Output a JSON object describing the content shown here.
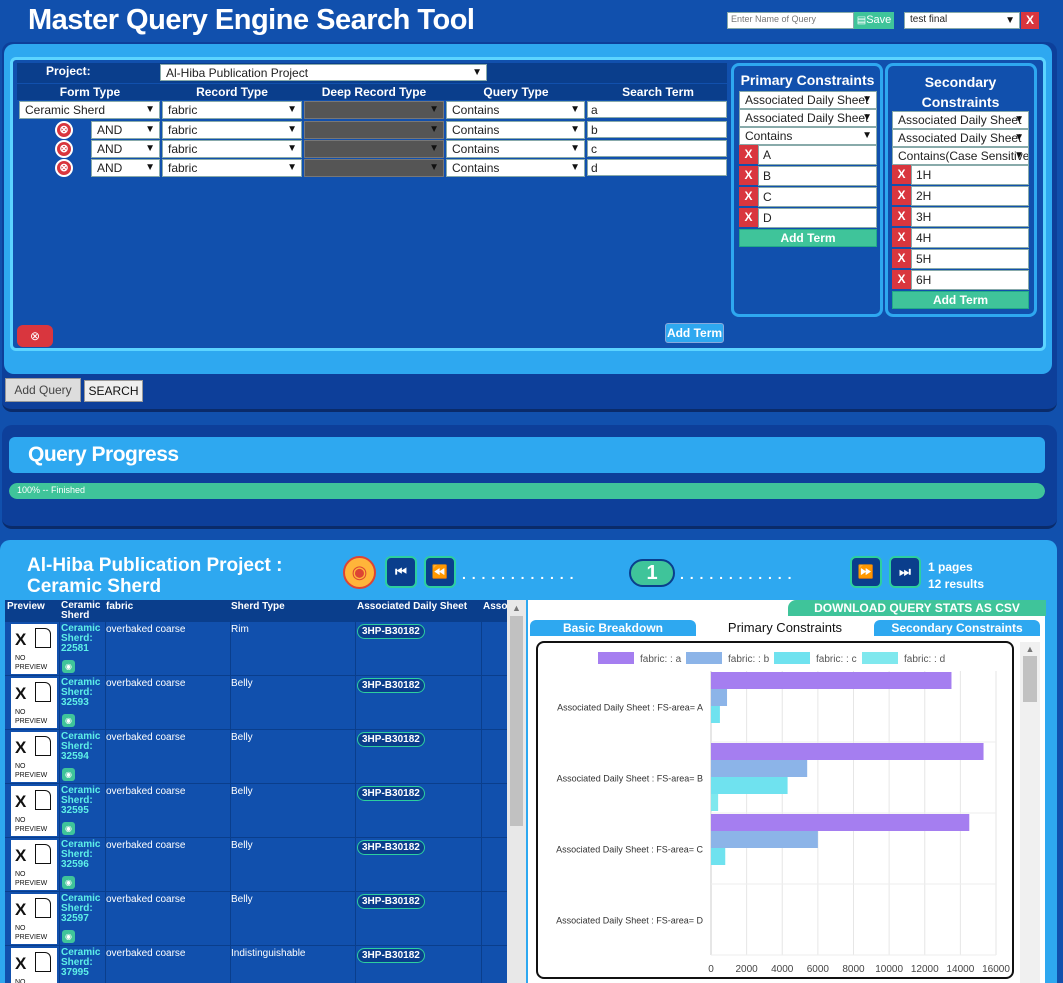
{
  "app": {
    "title": "Master Query Engine Search Tool"
  },
  "toolbar": {
    "query_name_placeholder": "Enter Name of Query",
    "save_label": "Save",
    "saved_query": "test final",
    "close_label": "X"
  },
  "builder": {
    "project_label": "Project:",
    "project_value": "Al-Hiba Publication Project",
    "columns": [
      "Form Type",
      "Record Type",
      "Deep Record Type",
      "Query Type",
      "Search Term"
    ],
    "first_row": {
      "form_type": "Ceramic Sherd",
      "record_type": "fabric",
      "deep_record_type": "",
      "query_type": "Contains",
      "search_term": "a"
    },
    "rows": [
      {
        "operator": "AND",
        "record_type": "fabric",
        "deep_record_type": "",
        "query_type": "Contains",
        "search_term": "b"
      },
      {
        "operator": "AND",
        "record_type": "fabric",
        "deep_record_type": "",
        "query_type": "Contains",
        "search_term": "c"
      },
      {
        "operator": "AND",
        "record_type": "fabric",
        "deep_record_type": "",
        "query_type": "Contains",
        "search_term": "d"
      }
    ],
    "add_term_label": "Add Term",
    "remove_icon": "⊗"
  },
  "primary": {
    "title": "Primary Constraints",
    "selects": [
      "Associated Daily Sheet",
      "Associated Daily Sheet",
      "Contains"
    ],
    "terms": [
      "A",
      "B",
      "C",
      "D"
    ],
    "add_term_label": "Add Term"
  },
  "secondary": {
    "title": "Secondary Constraints",
    "selects": [
      "Associated Daily Sheet",
      "Associated Daily Sheet",
      "Contains(Case Sensitive)"
    ],
    "terms": [
      "1H",
      "2H",
      "3H",
      "4H",
      "5H",
      "6H"
    ],
    "add_term_label": "Add Term"
  },
  "actions": {
    "add_query_label": "Add Query",
    "search_label": "SEARCH"
  },
  "progress": {
    "title": "Query Progress",
    "status_text": "100% -- Finished",
    "value": 1.0
  },
  "results": {
    "title_line1": "Al-Hiba Publication Project :",
    "title_line2": "Ceramic Sherd",
    "current_page": "1",
    "pages_text": "1 pages",
    "results_text": "12 results",
    "dots_left": ". . . . . . . . . . . .",
    "dots_right": ". . . . . . . . . . . .",
    "columns": [
      "Preview",
      "Ceramic Sherd",
      "fabric",
      "Sherd Type",
      "Associated Daily Sheet",
      "Asso"
    ],
    "no_preview_label": "NO PREVIEW",
    "rows": [
      {
        "name": "Ceramic Sherd: 22581",
        "fabric": "overbaked coarse",
        "sherd_type": "Rim",
        "daily_sheet": "3HP-B30182"
      },
      {
        "name": "Ceramic Sherd: 32593",
        "fabric": "overbaked coarse",
        "sherd_type": "Belly",
        "daily_sheet": "3HP-B30182"
      },
      {
        "name": "Ceramic Sherd: 32594",
        "fabric": "overbaked coarse",
        "sherd_type": "Belly",
        "daily_sheet": "3HP-B30182"
      },
      {
        "name": "Ceramic Sherd: 32595",
        "fabric": "overbaked coarse",
        "sherd_type": "Belly",
        "daily_sheet": "3HP-B30182"
      },
      {
        "name": "Ceramic Sherd: 32596",
        "fabric": "overbaked coarse",
        "sherd_type": "Belly",
        "daily_sheet": "3HP-B30182"
      },
      {
        "name": "Ceramic Sherd: 32597",
        "fabric": "overbaked coarse",
        "sherd_type": "Belly",
        "daily_sheet": "3HP-B30182"
      },
      {
        "name": "Ceramic Sherd: 37995",
        "fabric": "overbaked coarse",
        "sherd_type": "Indistinguishable",
        "daily_sheet": "3HP-B30182"
      }
    ]
  },
  "stats": {
    "download_label": "DOWNLOAD QUERY STATS AS CSV",
    "tabs": [
      "Basic Breakdown",
      "Primary Constraints",
      "Secondary Constraints"
    ],
    "active_tab": "Primary Constraints"
  },
  "colors": {
    "bg": "#1150ad",
    "accent": "#2dcf9e",
    "panel": "#2ea8f0",
    "danger": "#d9363e"
  },
  "chart_data": {
    "type": "bar",
    "orientation": "horizontal",
    "categories": [
      "Associated  Daily Sheet : FS-area= A",
      "Associated  Daily Sheet : FS-area= B",
      "Associated  Daily Sheet : FS-area= C",
      "Associated  Daily Sheet : FS-area= D"
    ],
    "series": [
      {
        "name": "fabric: : a",
        "color": "#a57ef0",
        "values": [
          13500,
          15300,
          14500,
          0
        ]
      },
      {
        "name": "fabric: : b",
        "color": "#8cb4e8",
        "values": [
          900,
          5400,
          6000,
          0
        ]
      },
      {
        "name": "fabric: : c",
        "color": "#6fe2ef",
        "values": [
          500,
          4300,
          800,
          0
        ]
      },
      {
        "name": "fabric: : d",
        "color": "#7fe8ee",
        "values": [
          0,
          400,
          0,
          0
        ]
      }
    ],
    "xlim": [
      0,
      16000
    ],
    "xticks": [
      "0",
      "2000",
      "4000",
      "6000",
      "8000",
      "10000",
      "12000",
      "14000",
      "16000"
    ],
    "legend": "top",
    "grid": true
  }
}
